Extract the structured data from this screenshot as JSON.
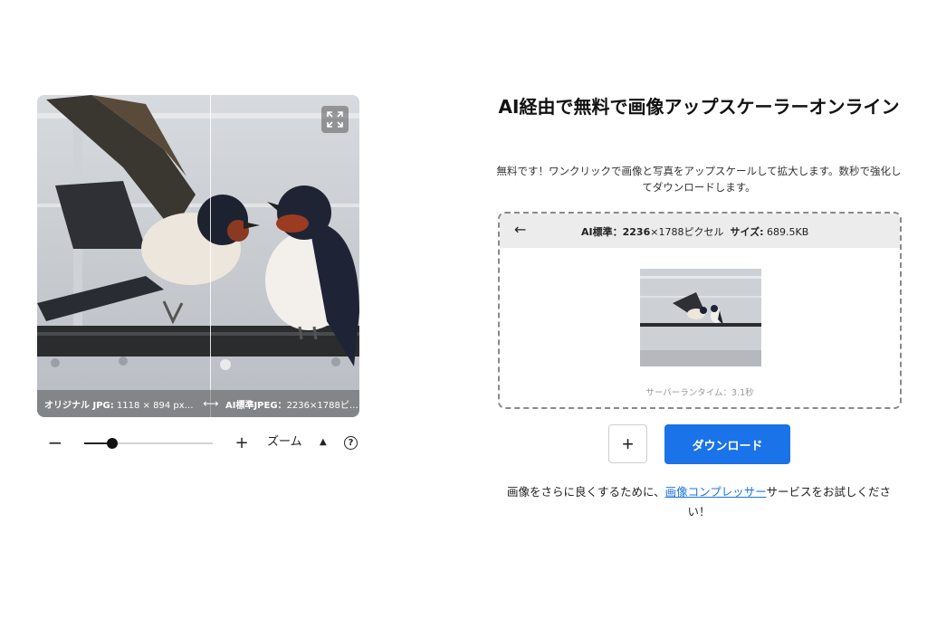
{
  "viewer": {
    "expand_icon": "expand-icon",
    "original_caption_label": "オリジナル JPG:",
    "original_caption_value": "1118 × 894 px…",
    "compare_arrow": "⟷",
    "upscaled_caption_label": "AI標準JPEG：",
    "upscaled_caption_value": "2236×1788ピ…"
  },
  "zoom_controls": {
    "minus_label": "−",
    "plus_label": "+",
    "zoom_label": "ズーム",
    "caret": "▲",
    "help": "?",
    "slider_level": 0.22
  },
  "panel": {
    "title": "AI経由で無料で画像アップスケーラーオンライン",
    "description": "無料です！ワンクリックで画像と写真をアップスケールして拡大します。数秒で強化してダウンロードします。",
    "result": {
      "back_icon": "←",
      "quality_label": "AI標準：",
      "resolution": "2236",
      "resolution_rest": "×1788ピクセル",
      "size_label": "サイズ:",
      "size_value": "689.5KB",
      "runtime": "サーバーランタイム：3.1秒"
    },
    "add_label": "+",
    "download_label": "ダウンロード",
    "note_prefix": "画像をさらに良くするために、",
    "note_link": "画像コンプレッサー",
    "note_suffix": "サービスをお試しください！"
  },
  "colors": {
    "accent": "#1a73e8",
    "header_bg": "#ececec",
    "dashed_border": "#8a8a8a"
  }
}
